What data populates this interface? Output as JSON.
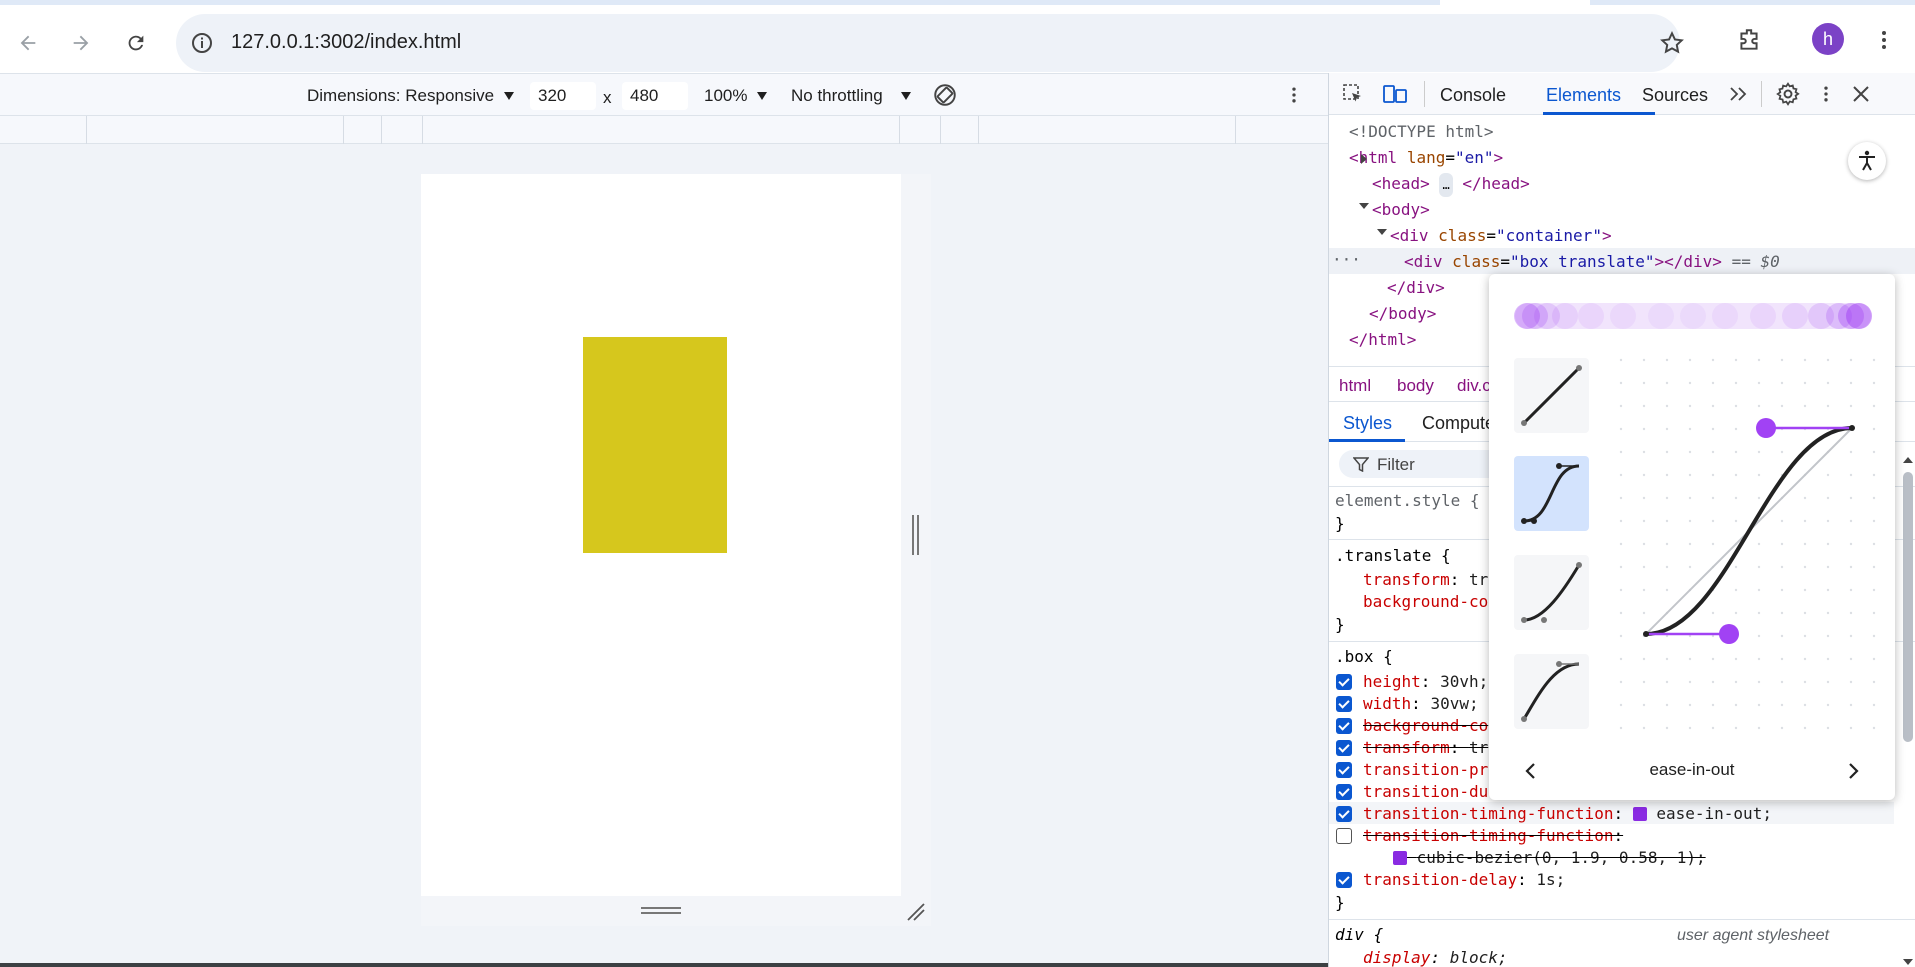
{
  "browser": {
    "url": "127.0.0.1:3002/index.html",
    "avatar_letter": "h"
  },
  "device_toolbar": {
    "dimensions_label": "Dimensions: Responsive",
    "width": "320",
    "height": "480",
    "times": "x",
    "zoom": "100%",
    "throttling": "No throttling"
  },
  "devtools": {
    "tabs": [
      "Console",
      "Elements",
      "Sources"
    ],
    "active_tab": "Elements",
    "dom": {
      "doctype": "<!DOCTYPE html>",
      "html_open": "<html",
      "lang_attr": "lang",
      "lang_val": "\"en\"",
      "head": "<head>",
      "head_ellipsis": "…",
      "head_close": "</head>",
      "body_open": "<body>",
      "div_open": "<div",
      "class_attr": "class",
      "container_val": "\"container\"",
      "box_val": "\"box translate\"",
      "div_close": "></div>",
      "eq0": "== $0",
      "div_end": "</div>",
      "body_close": "</body>",
      "html_close": "</html>"
    },
    "breadcrumbs": [
      "html",
      "body",
      "div.c"
    ],
    "subtabs": [
      "Styles",
      "Compute"
    ],
    "filter_placeholder": "Filter",
    "styles": {
      "element_style": "element.style {",
      "close_brace": "}",
      "translate_selector": ".translate {",
      "translate_props": [
        {
          "name": "transform",
          "value": "tr"
        },
        {
          "name": "background-co",
          "value": ""
        }
      ],
      "box_selector": ".box {",
      "box_props": [
        {
          "name": "height",
          "value": "30vh;",
          "checked": true,
          "struck": false
        },
        {
          "name": "width",
          "value": "30vw;",
          "checked": true,
          "struck": false
        },
        {
          "name": "background-co",
          "value": "",
          "checked": true,
          "struck": true
        },
        {
          "name": "transform",
          "value": "tr",
          "checked": true,
          "struck": true
        },
        {
          "name": "transition-pr",
          "value": "",
          "checked": true,
          "struck": false
        },
        {
          "name": "transition-du",
          "value": "",
          "checked": true,
          "struck": false
        },
        {
          "name": "transition-timing-function",
          "value": "ease-in-out;",
          "checked": true,
          "struck": false
        },
        {
          "name": "transition-timing-function",
          "value": "cubic-bezier(0, 1.9, 0.58, 1);",
          "checked": false,
          "struck": true
        },
        {
          "name": "transition-delay",
          "value": "1s;",
          "checked": true,
          "struck": false
        }
      ],
      "div_selector": "div {",
      "ua_label": "user agent stylesheet",
      "div_prop": {
        "name": "display",
        "value": "block;"
      }
    },
    "easing_popover": {
      "current": "ease-in-out",
      "presets": [
        "linear",
        "ease-in-out",
        "ease-in",
        "ease-out"
      ],
      "selected_preset": "ease-in-out",
      "accent_color": "#a142f4"
    }
  }
}
